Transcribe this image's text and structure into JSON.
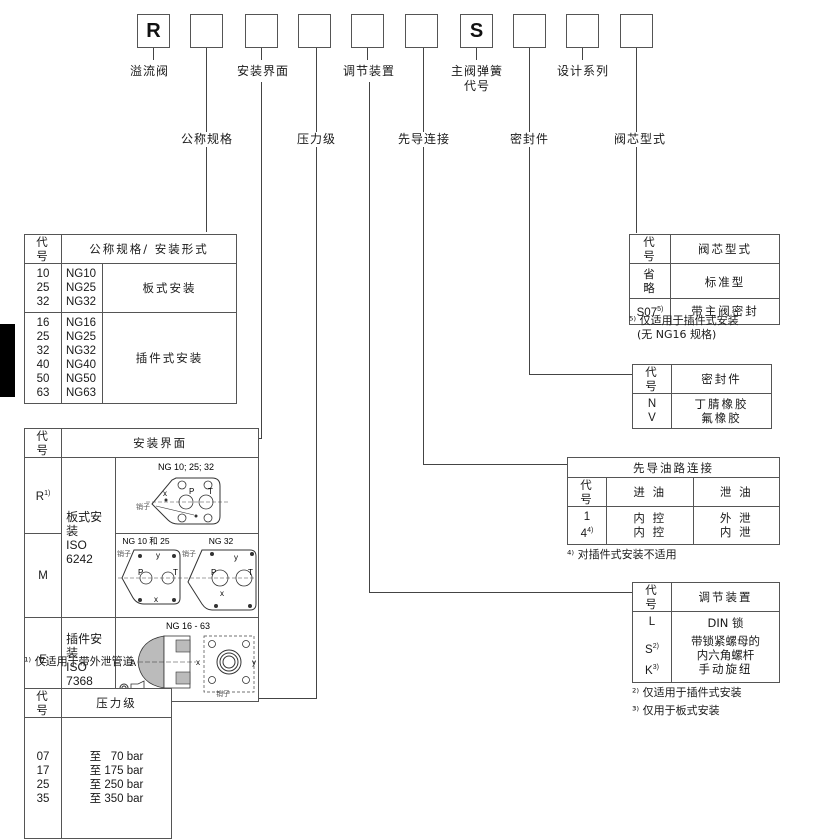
{
  "code_boxes": [
    {
      "value": "R",
      "label": "溢流阀"
    },
    {
      "value": "",
      "label": "公称规格"
    },
    {
      "value": "",
      "label": "安装界面"
    },
    {
      "value": "",
      "label": "压力级"
    },
    {
      "value": "",
      "label": "调节装置"
    },
    {
      "value": "",
      "label": "先导连接"
    },
    {
      "value": "S",
      "label": "主阀弹簧代号"
    },
    {
      "value": "",
      "label": "密封件"
    },
    {
      "value": "",
      "label": "设计系列"
    },
    {
      "value": "",
      "label": "阀芯型式"
    }
  ],
  "top_labels": {
    "relief_valve": "溢流阀",
    "mounting_interface": "安装界面",
    "adjustment": "调节装置",
    "main_spring_line1": "主阀弹簧",
    "main_spring_line2": "代号",
    "design_series": "设计系列"
  },
  "mid_labels": {
    "nominal_size": "公称规格",
    "pressure_rating": "压力级",
    "pilot_connection": "先导连接",
    "seals": "密封件",
    "spool_type": "阀芯型式"
  },
  "size_table": {
    "header_code": "代 号",
    "header_desc": "公称规格/ 安装形式",
    "groups": [
      {
        "codes": [
          "10",
          "25",
          "32"
        ],
        "sizes": [
          "NG10",
          "NG25",
          "NG32"
        ],
        "mounting": "板式安装"
      },
      {
        "codes": [
          "16",
          "25",
          "32",
          "40",
          "50",
          "63"
        ],
        "sizes": [
          "NG16",
          "NG25",
          "NG32",
          "NG40",
          "NG50",
          "NG63"
        ],
        "mounting": "插件式安装"
      }
    ]
  },
  "interface_table": {
    "header_code": "代 号",
    "header_desc": "安装界面",
    "rows": [
      {
        "code": "R",
        "sup": "1)",
        "drawing_title": "NG 10; 25; 32"
      },
      {
        "code": "M",
        "sup": "",
        "drawing_title_a": "NG 10 和 25",
        "drawing_title_b": "NG 32"
      },
      {
        "code": "E",
        "sup": "",
        "drawing_title": "NG 16 - 63"
      }
    ],
    "subplate_label_1": "板式安装",
    "subplate_label_2": "ISO 6242",
    "cartridge_label_1": "插件安装",
    "cartridge_label_2": "ISO 7368",
    "pin_label": "销子",
    "port_labels": {
      "P": "P",
      "T": "T",
      "X": "x",
      "Y": "y",
      "A": "A",
      "B": "B"
    },
    "footnote": "¹⁾ 仅适用于带外泄管道"
  },
  "pressure_table": {
    "header_code": "代 号",
    "header_desc": "压力级",
    "rows": [
      {
        "code": "07",
        "desc": "至   70 bar"
      },
      {
        "code": "17",
        "desc": "至 175 bar"
      },
      {
        "code": "25",
        "desc": "至 250 bar"
      },
      {
        "code": "35",
        "desc": "至 350 bar"
      }
    ]
  },
  "spool_table": {
    "header_code": "代 号",
    "header_desc": "阀芯型式",
    "rows": [
      {
        "code": "省 略",
        "sup": "",
        "desc": "标准型"
      },
      {
        "code": "S07",
        "sup": "5)",
        "desc": "带主阀密封"
      }
    ],
    "footnote_line1": "⁵⁾ 仅适用于插件式安装",
    "footnote_line2": "(无 NG16 规格)"
  },
  "seal_table": {
    "header_code": "代 号",
    "header_desc": "密封件",
    "rows": [
      {
        "code": "N",
        "desc": "丁腈橡胶"
      },
      {
        "code": "V",
        "desc": "氟橡胶"
      }
    ]
  },
  "pilot_table": {
    "title": "先导油路连接",
    "header_code": "代 号",
    "header_in": "进 油",
    "header_drain": "泄 油",
    "rows": [
      {
        "code": "1",
        "sup": "",
        "in": "内 控",
        "drain": "外 泄"
      },
      {
        "code": "4",
        "sup": "4)",
        "in": "内 控",
        "drain": "内 泄"
      }
    ],
    "footnote": "⁴⁾ 对插件式安装不适用"
  },
  "adjust_table": {
    "header_code": "代 号",
    "header_desc": "调节装置",
    "rows": [
      {
        "code": "L",
        "sup": "",
        "desc_line1": "DIN 锁",
        "desc_line2": ""
      },
      {
        "code": "S",
        "sup": "2)",
        "desc_line1": "带锁紧螺母的",
        "desc_line2": "内六角螺杆"
      },
      {
        "code": "K",
        "sup": "3)",
        "desc_line1": "手动旋纽",
        "desc_line2": ""
      }
    ],
    "footnote1": "²⁾ 仅适用于插件式安装",
    "footnote2": "³⁾ 仅用于板式安装"
  }
}
